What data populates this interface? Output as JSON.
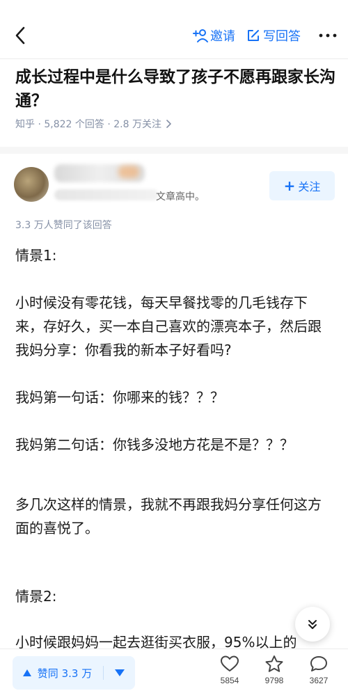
{
  "header": {
    "invite_label": "邀请",
    "write_label": "写回答"
  },
  "question": {
    "title": "成长过程中是什么导致了孩子不愿再跟家长沟通？",
    "meta": "知乎 · 5,822 个回答 · 2.8 万关注"
  },
  "author": {
    "bio_visible": "文章高中。",
    "follow_label": "关注"
  },
  "answer": {
    "vote_summary": "3.3 万人赞同了该回答",
    "paragraphs": [
      "情景1:",
      "小时候没有零花钱，每天早餐找零的几毛钱存下来，存好久，买一本自己喜欢的漂亮本子，然后跟我妈分享：你看我的新本子好看吗?",
      "我妈第一句话：你哪来的钱？？？",
      "我妈第二句话：你钱多没地方花是不是？？？",
      "多几次这样的情景，我就不再跟我妈分享任何这方面的喜悦了。",
      "情景2:",
      "小时候跟妈妈一起去逛街买衣服，95%以上的"
    ]
  },
  "bottom": {
    "upvote_label": "赞同 3.3 万",
    "comments_count": "5854",
    "favorites_count": "9798",
    "discuss_count": "3627"
  },
  "colors": {
    "accent": "#1772f6",
    "accent_bg": "#ebf5ff",
    "meta_gray": "#8590a6"
  }
}
